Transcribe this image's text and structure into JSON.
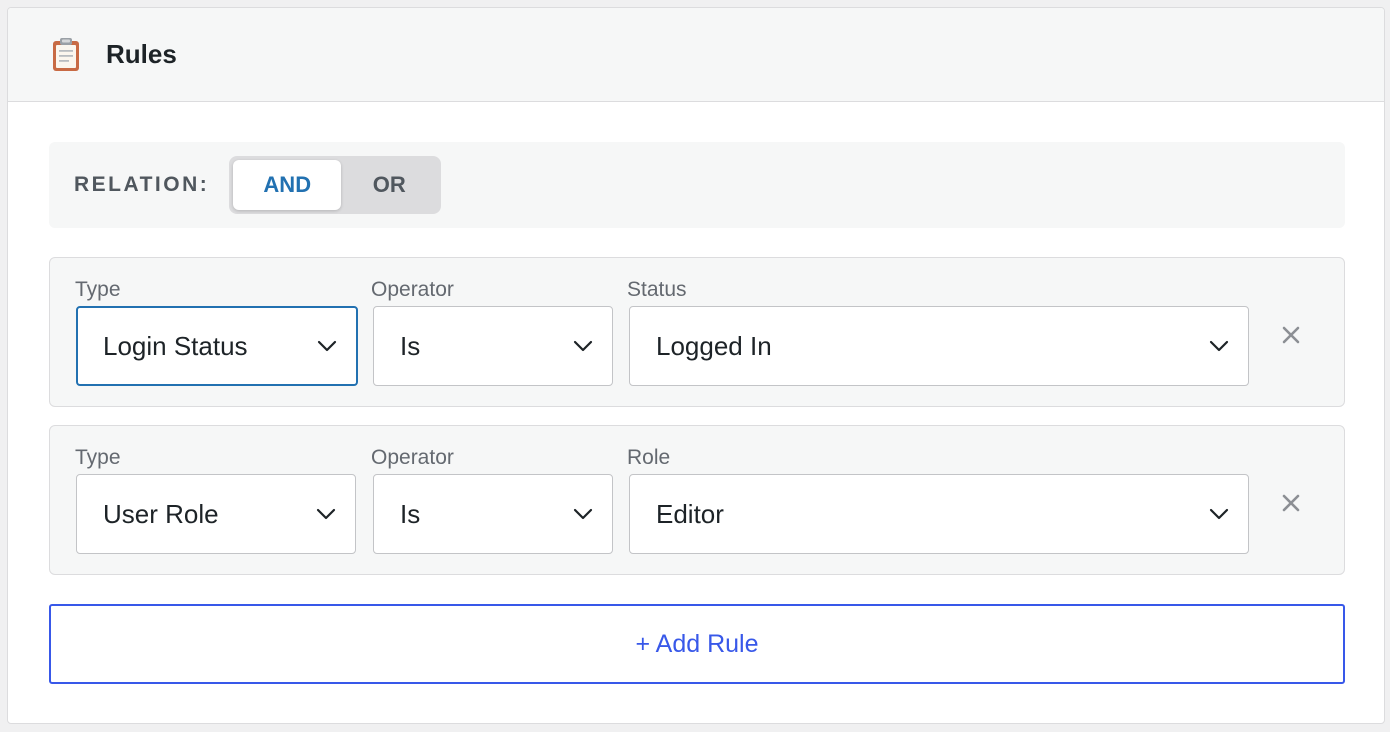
{
  "panel": {
    "title": "Rules",
    "icon": "clipboard-icon"
  },
  "relation": {
    "label": "RELATION:",
    "options": [
      "AND",
      "OR"
    ],
    "selected": "AND"
  },
  "rules": [
    {
      "type_label": "Type",
      "type_value": "Login Status",
      "operator_label": "Operator",
      "operator_value": "Is",
      "value_label": "Status",
      "value_value": "Logged In"
    },
    {
      "type_label": "Type",
      "type_value": "User Role",
      "operator_label": "Operator",
      "operator_value": "Is",
      "value_label": "Role",
      "value_value": "Editor"
    }
  ],
  "add_rule_label": "+ Add Rule",
  "colors": {
    "accent": "#2271b1",
    "add_button": "#3858e9",
    "panel_bg": "#f6f7f7",
    "border": "#dcdcde"
  }
}
